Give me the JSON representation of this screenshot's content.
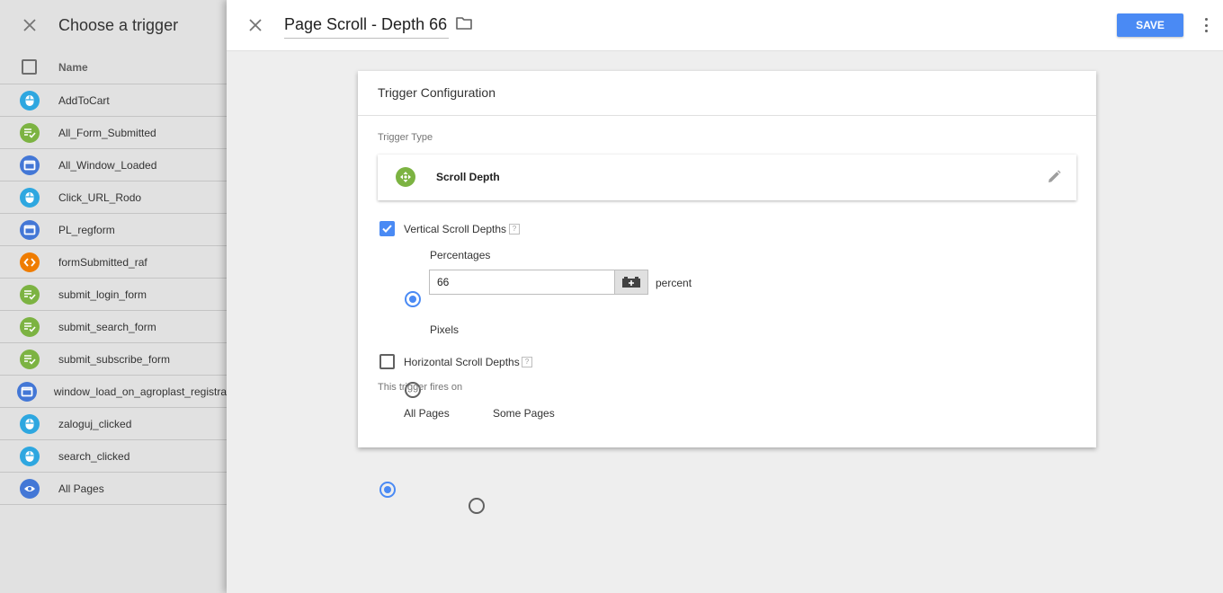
{
  "sidebar": {
    "title": "Choose a trigger",
    "column_name": "Name",
    "items": [
      {
        "label": "AddToCart",
        "icon": "mouse-click-icon",
        "color": "#2ea7e0"
      },
      {
        "label": "All_Form_Submitted",
        "icon": "form-submit-icon",
        "color": "#7cb342"
      },
      {
        "label": "All_Window_Loaded",
        "icon": "window-icon",
        "color": "#4377d6"
      },
      {
        "label": "Click_URL_Rodo",
        "icon": "mouse-click-icon",
        "color": "#2ea7e0"
      },
      {
        "label": "PL_regform",
        "icon": "window-icon",
        "color": "#4377d6"
      },
      {
        "label": "formSubmitted_raf",
        "icon": "custom-event-icon",
        "color": "#ef7c00"
      },
      {
        "label": "submit_login_form",
        "icon": "form-submit-icon",
        "color": "#7cb342"
      },
      {
        "label": "submit_search_form",
        "icon": "form-submit-icon",
        "color": "#7cb342"
      },
      {
        "label": "submit_subscribe_form",
        "icon": "form-submit-icon",
        "color": "#7cb342"
      },
      {
        "label": "window_load_on_agroplast_registra",
        "icon": "window-icon",
        "color": "#4377d6"
      },
      {
        "label": "zaloguj_clicked",
        "icon": "mouse-click-icon",
        "color": "#2ea7e0"
      },
      {
        "label": "search_clicked",
        "icon": "mouse-click-icon",
        "color": "#2ea7e0"
      },
      {
        "label": "All Pages",
        "icon": "eye-icon",
        "color": "#4377d6"
      }
    ]
  },
  "editor": {
    "trigger_name": "Page Scroll - Depth 66",
    "save_label": "SAVE",
    "card_title": "Trigger Configuration",
    "trigger_type_label": "Trigger Type",
    "trigger_type_name": "Scroll Depth",
    "vertical_label": "Vertical Scroll Depths",
    "vertical_checked": true,
    "percentages_label": "Percentages",
    "percentages_selected": true,
    "depth_value": "66",
    "depth_unit": "percent",
    "pixels_label": "Pixels",
    "horizontal_label": "Horizontal Scroll Depths",
    "horizontal_checked": false,
    "fires_on_label": "This trigger fires on",
    "all_pages_label": "All Pages",
    "all_pages_selected": true,
    "some_pages_label": "Some Pages",
    "help_glyph": "?"
  },
  "colors": {
    "accent": "#4a8af4",
    "scroll_depth_icon": "#7cb342"
  }
}
